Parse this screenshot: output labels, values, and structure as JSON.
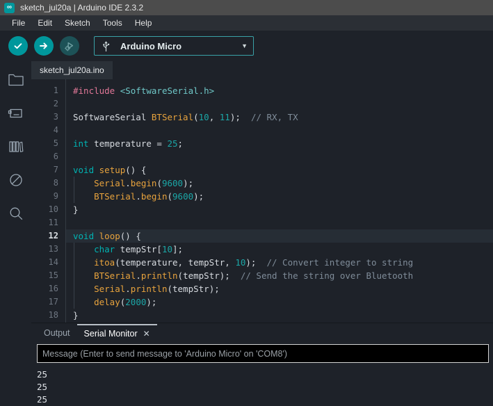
{
  "window": {
    "title": "sketch_jul20a | Arduino IDE 2.3.2",
    "app_icon": "arduino-logo-icon",
    "titlebar_color": "#4c4c4c"
  },
  "menubar": {
    "items": [
      {
        "label": "File"
      },
      {
        "label": "Edit"
      },
      {
        "label": "Sketch"
      },
      {
        "label": "Tools"
      },
      {
        "label": "Help"
      }
    ]
  },
  "toolbar": {
    "verify": {
      "icon": "checkmark-icon",
      "tooltip": "Verify",
      "color": "#00979c"
    },
    "upload": {
      "icon": "arrow-right-icon",
      "tooltip": "Upload",
      "color": "#00979c"
    },
    "debug": {
      "icon": "debug-icon",
      "tooltip": "Debug",
      "color": "#1d5257",
      "enabled": false
    },
    "board_selector": {
      "icon": "usb-icon",
      "value": "Arduino Micro",
      "caret": "chevron-down-icon",
      "border_color": "#39a2a7"
    }
  },
  "sidebar": {
    "items": [
      {
        "icon": "folder-icon",
        "name": "sketchbook"
      },
      {
        "icon": "board-manager-icon",
        "name": "boards-manager"
      },
      {
        "icon": "library-icon",
        "name": "library-manager"
      },
      {
        "icon": "debug-disabled-icon",
        "name": "debug"
      },
      {
        "icon": "search-icon",
        "name": "search"
      }
    ]
  },
  "editor": {
    "tabs": [
      {
        "label": "sketch_jul20a.ino",
        "active": true
      }
    ],
    "current_line": 12,
    "lines": [
      {
        "n": 1,
        "tokens": [
          {
            "t": "#include ",
            "c": "t-pre"
          },
          {
            "t": "<SoftwareSerial.h>",
            "c": "t-inc"
          }
        ]
      },
      {
        "n": 2,
        "tokens": []
      },
      {
        "n": 3,
        "tokens": [
          {
            "t": "SoftwareSerial ",
            "c": "t-plain"
          },
          {
            "t": "BTSerial",
            "c": "t-fn"
          },
          {
            "t": "(",
            "c": "t-plain"
          },
          {
            "t": "10",
            "c": "t-num"
          },
          {
            "t": ", ",
            "c": "t-plain"
          },
          {
            "t": "11",
            "c": "t-num"
          },
          {
            "t": ");  ",
            "c": "t-plain"
          },
          {
            "t": "// RX, TX",
            "c": "t-cmt"
          }
        ]
      },
      {
        "n": 4,
        "tokens": []
      },
      {
        "n": 5,
        "tokens": [
          {
            "t": "int",
            "c": "t-type"
          },
          {
            "t": " temperature = ",
            "c": "t-plain"
          },
          {
            "t": "25",
            "c": "t-num"
          },
          {
            "t": ";",
            "c": "t-plain"
          }
        ]
      },
      {
        "n": 6,
        "tokens": []
      },
      {
        "n": 7,
        "tokens": [
          {
            "t": "void",
            "c": "t-type"
          },
          {
            "t": " ",
            "c": "t-plain"
          },
          {
            "t": "setup",
            "c": "t-fn"
          },
          {
            "t": "() {",
            "c": "t-plain"
          }
        ]
      },
      {
        "n": 8,
        "tokens": [
          {
            "t": "    ",
            "c": "t-plain"
          },
          {
            "t": "Serial",
            "c": "t-fn"
          },
          {
            "t": ".",
            "c": "t-plain"
          },
          {
            "t": "begin",
            "c": "t-fn"
          },
          {
            "t": "(",
            "c": "t-plain"
          },
          {
            "t": "9600",
            "c": "t-num"
          },
          {
            "t": ");",
            "c": "t-plain"
          }
        ]
      },
      {
        "n": 9,
        "tokens": [
          {
            "t": "    ",
            "c": "t-plain"
          },
          {
            "t": "BTSerial",
            "c": "t-fn"
          },
          {
            "t": ".",
            "c": "t-plain"
          },
          {
            "t": "begin",
            "c": "t-fn"
          },
          {
            "t": "(",
            "c": "t-plain"
          },
          {
            "t": "9600",
            "c": "t-num"
          },
          {
            "t": ");",
            "c": "t-plain"
          }
        ]
      },
      {
        "n": 10,
        "tokens": [
          {
            "t": "}",
            "c": "t-plain"
          }
        ]
      },
      {
        "n": 11,
        "tokens": []
      },
      {
        "n": 12,
        "tokens": [
          {
            "t": "void",
            "c": "t-type"
          },
          {
            "t": " ",
            "c": "t-plain"
          },
          {
            "t": "loop",
            "c": "t-fn"
          },
          {
            "t": "() {",
            "c": "t-plain"
          }
        ]
      },
      {
        "n": 13,
        "tokens": [
          {
            "t": "    ",
            "c": "t-plain"
          },
          {
            "t": "char",
            "c": "t-type"
          },
          {
            "t": " tempStr[",
            "c": "t-plain"
          },
          {
            "t": "10",
            "c": "t-num"
          },
          {
            "t": "];",
            "c": "t-plain"
          }
        ]
      },
      {
        "n": 14,
        "tokens": [
          {
            "t": "    ",
            "c": "t-plain"
          },
          {
            "t": "itoa",
            "c": "t-fn"
          },
          {
            "t": "(temperature, tempStr, ",
            "c": "t-plain"
          },
          {
            "t": "10",
            "c": "t-num"
          },
          {
            "t": ");  ",
            "c": "t-plain"
          },
          {
            "t": "// Convert integer to string",
            "c": "t-cmt"
          }
        ]
      },
      {
        "n": 15,
        "tokens": [
          {
            "t": "    ",
            "c": "t-plain"
          },
          {
            "t": "BTSerial",
            "c": "t-fn"
          },
          {
            "t": ".",
            "c": "t-plain"
          },
          {
            "t": "println",
            "c": "t-fn"
          },
          {
            "t": "(tempStr);  ",
            "c": "t-plain"
          },
          {
            "t": "// Send the string over Bluetooth",
            "c": "t-cmt"
          }
        ]
      },
      {
        "n": 16,
        "tokens": [
          {
            "t": "    ",
            "c": "t-plain"
          },
          {
            "t": "Serial",
            "c": "t-fn"
          },
          {
            "t": ".",
            "c": "t-plain"
          },
          {
            "t": "println",
            "c": "t-fn"
          },
          {
            "t": "(tempStr);",
            "c": "t-plain"
          }
        ]
      },
      {
        "n": 17,
        "tokens": [
          {
            "t": "    ",
            "c": "t-plain"
          },
          {
            "t": "delay",
            "c": "t-fn"
          },
          {
            "t": "(",
            "c": "t-plain"
          },
          {
            "t": "2000",
            "c": "t-num"
          },
          {
            "t": ");",
            "c": "t-plain"
          }
        ]
      },
      {
        "n": 18,
        "tokens": [
          {
            "t": "}",
            "c": "t-plain"
          }
        ]
      }
    ]
  },
  "bottom_panel": {
    "tabs": [
      {
        "label": "Output",
        "active": false,
        "closable": false
      },
      {
        "label": "Serial Monitor",
        "active": true,
        "closable": true,
        "close_icon": "close-icon"
      }
    ],
    "message_input": {
      "value": "",
      "placeholder": "Message (Enter to send message to 'Arduino Micro' on 'COM8')"
    },
    "serial_output": [
      "25",
      "25",
      "25"
    ]
  }
}
